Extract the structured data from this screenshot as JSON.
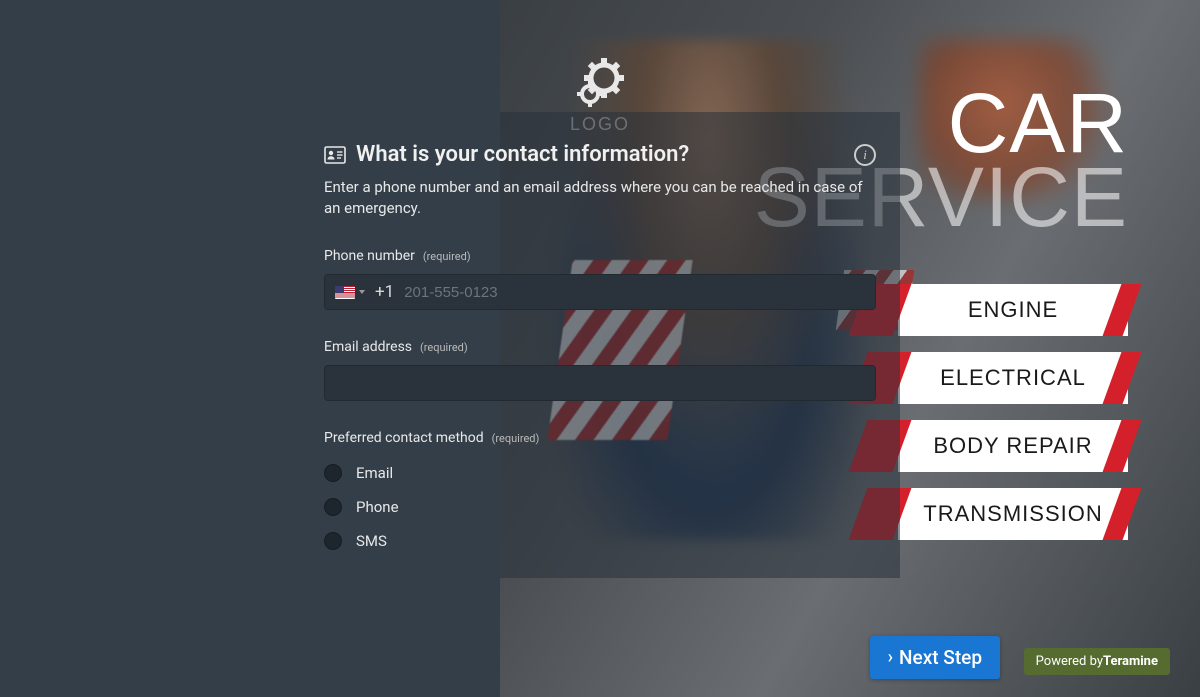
{
  "logo_text": "LOGO",
  "banner": {
    "line1": "CAR",
    "line2": "SERVICE"
  },
  "tiles": [
    "ENGINE",
    "ELECTRICAL",
    "BODY REPAIR",
    "TRANSMISSION"
  ],
  "form": {
    "heading": "What is your contact information?",
    "subheading": "Enter a phone number and an email address where you can be reached in case of an emergency.",
    "required_text": "(required)",
    "phone": {
      "label": "Phone number",
      "dial_code": "+1",
      "placeholder": "201-555-0123",
      "value": ""
    },
    "email": {
      "label": "Email address",
      "value": ""
    },
    "contact_method": {
      "label": "Preferred contact method",
      "options": [
        "Email",
        "Phone",
        "SMS"
      ]
    }
  },
  "next_button": "Next Step",
  "powered_prefix": "Powered by",
  "powered_brand": "Teramine"
}
